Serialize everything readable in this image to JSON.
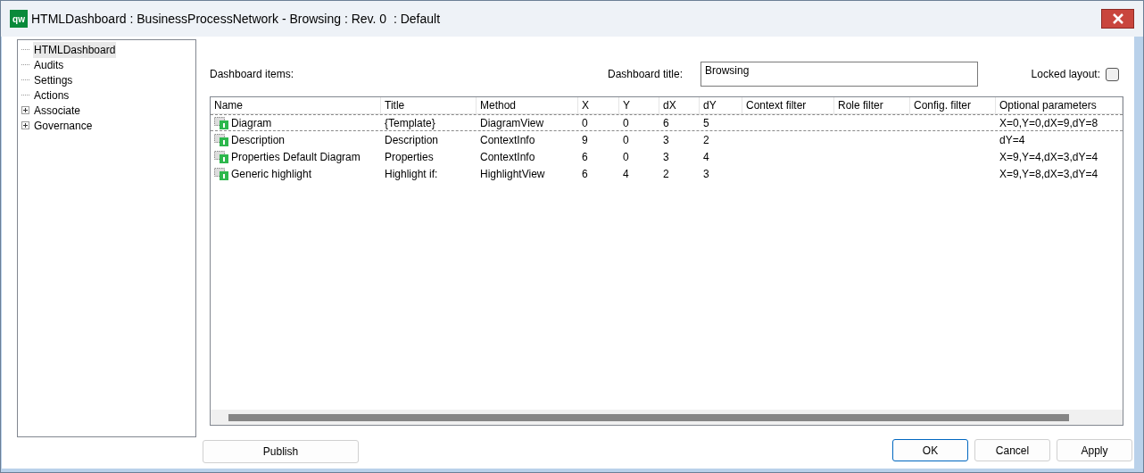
{
  "window": {
    "title": "HTMLDashboard : BusinessProcessNetwork - Browsing : Rev. 0  : Default",
    "app_icon": "qw"
  },
  "tree": [
    {
      "label": "HTMLDashboard",
      "selected": true
    },
    {
      "label": "Audits",
      "selected": false
    },
    {
      "label": "Settings",
      "selected": false
    },
    {
      "label": "Actions",
      "selected": false
    },
    {
      "label": "Associate",
      "selected": false,
      "expanded": false
    },
    {
      "label": "Governance",
      "selected": false,
      "expanded": false
    }
  ],
  "dashboard_items_label": "Dashboard items:",
  "dashboard_title": {
    "label": "Dashboard title:",
    "value": "Browsing"
  },
  "locked_layout": {
    "label": "Locked layout:",
    "checked": false
  },
  "table": {
    "columns": [
      "Name",
      "Title",
      "Method",
      "X",
      "Y",
      "dX",
      "dY",
      "Context filter",
      "Role filter",
      "Config. filter",
      "Optional parameters"
    ],
    "rows": [
      {
        "selected": true,
        "cells": [
          "Diagram",
          "{Template}",
          "DiagramView",
          "0",
          "0",
          "6",
          "5",
          "",
          "",
          "",
          "X=0,Y=0,dX=9,dY=8"
        ]
      },
      {
        "selected": false,
        "cells": [
          "Description",
          "Description",
          "ContextInfo",
          "9",
          "0",
          "3",
          "2",
          "",
          "",
          "",
          "dY=4"
        ]
      },
      {
        "selected": false,
        "cells": [
          "Properties Default Diagram",
          "Properties",
          "ContextInfo",
          "6",
          "0",
          "3",
          "4",
          "",
          "",
          "",
          "X=9,Y=4,dX=3,dY=4"
        ]
      },
      {
        "selected": false,
        "cells": [
          "Generic highlight",
          "Highlight if:",
          "HighlightView",
          "6",
          "4",
          "2",
          "3",
          "",
          "",
          "",
          "X=9,Y=8,dX=3,dY=4"
        ]
      }
    ]
  },
  "buttons": [
    {
      "label": "Publish",
      "kind": "left"
    },
    {
      "label": "OK",
      "kind": "default"
    },
    {
      "label": "Cancel",
      "kind": "normal"
    },
    {
      "label": "Apply",
      "kind": "normal"
    }
  ]
}
